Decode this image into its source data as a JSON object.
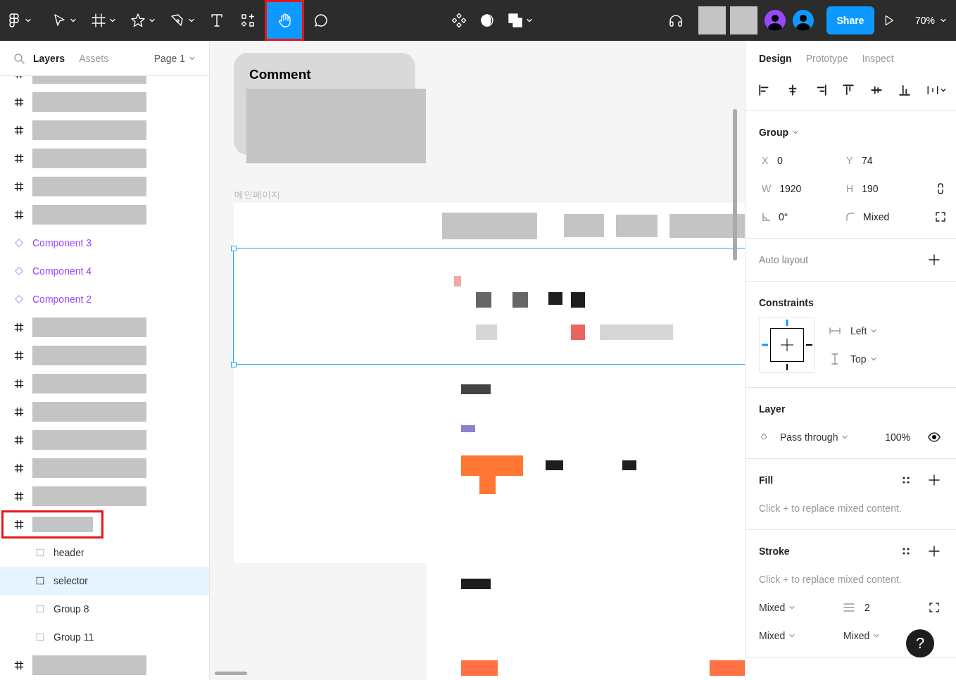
{
  "toolbar": {
    "tools": [
      {
        "kind": "logo",
        "caret": true,
        "selected": false,
        "annotated": false
      },
      {
        "kind": "move",
        "caret": true,
        "selected": false,
        "annotated": false
      },
      {
        "kind": "frame",
        "caret": true,
        "selected": false,
        "annotated": false
      },
      {
        "kind": "shape",
        "caret": true,
        "selected": false,
        "annotated": false
      },
      {
        "kind": "pen",
        "caret": true,
        "selected": false,
        "annotated": false
      },
      {
        "kind": "text",
        "caret": false,
        "selected": false,
        "annotated": false
      },
      {
        "kind": "resources",
        "caret": false,
        "selected": false,
        "annotated": false
      },
      {
        "kind": "hand",
        "caret": false,
        "selected": true,
        "annotated": true
      },
      {
        "kind": "comment",
        "caret": false,
        "selected": false,
        "annotated": false
      }
    ],
    "center_tools": [
      {
        "kind": "component",
        "caret": false
      },
      {
        "kind": "mask",
        "caret": false
      },
      {
        "kind": "boolean",
        "caret": true
      }
    ],
    "avatars": [
      {
        "color": "#9747ff"
      },
      {
        "color": "#0d99ff"
      }
    ],
    "share": "Share",
    "zoom": "70%"
  },
  "layers": {
    "tabs": [
      {
        "label": "Layers",
        "selected": true
      },
      {
        "label": "Assets",
        "selected": false
      }
    ],
    "page": "Page 1",
    "items": [
      {
        "kind": "frame",
        "redacted": true,
        "selected": false,
        "annotated": false
      },
      {
        "kind": "frame",
        "redacted": true,
        "selected": false,
        "annotated": false
      },
      {
        "kind": "frame",
        "redacted": true,
        "selected": false,
        "annotated": false
      },
      {
        "kind": "frame",
        "redacted": true,
        "selected": false,
        "annotated": false
      },
      {
        "kind": "frame",
        "redacted": true,
        "selected": false,
        "annotated": false
      },
      {
        "kind": "frame",
        "redacted": true,
        "selected": false,
        "annotated": false
      },
      {
        "kind": "component",
        "label": "Component 3",
        "selected": false,
        "annotated": false
      },
      {
        "kind": "component",
        "label": "Component 4",
        "selected": false,
        "annotated": false
      },
      {
        "kind": "component",
        "label": "Component 2",
        "selected": false,
        "annotated": false
      },
      {
        "kind": "frame",
        "redacted": true,
        "selected": false,
        "annotated": false
      },
      {
        "kind": "frame",
        "redacted": true,
        "selected": false,
        "annotated": false
      },
      {
        "kind": "frame",
        "redacted": true,
        "selected": false,
        "annotated": false
      },
      {
        "kind": "frame",
        "redacted": true,
        "selected": false,
        "annotated": false
      },
      {
        "kind": "frame",
        "redacted": true,
        "selected": false,
        "annotated": false
      },
      {
        "kind": "frame",
        "redacted": true,
        "selected": false,
        "annotated": false
      },
      {
        "kind": "frame",
        "redacted": true,
        "selected": false,
        "annotated": false
      },
      {
        "kind": "frame",
        "redacted": true,
        "selected": false,
        "annotated": true,
        "children": [
          {
            "kind": "group",
            "label": "header",
            "selected": false,
            "annotated": false
          },
          {
            "kind": "group",
            "label": "selector",
            "selected": true,
            "annotated": false
          },
          {
            "kind": "group",
            "label": "Group 8",
            "selected": false,
            "annotated": false
          },
          {
            "kind": "group",
            "label": "Group 11",
            "selected": false,
            "annotated": false
          }
        ]
      },
      {
        "kind": "frame",
        "redacted": true,
        "selected": false,
        "annotated": false
      }
    ]
  },
  "canvas": {
    "comment_card": {
      "title": "Comment"
    },
    "frame_label": "메인페이지"
  },
  "design_panel": {
    "tabs": [
      {
        "label": "Design",
        "selected": true
      },
      {
        "label": "Prototype",
        "selected": false
      },
      {
        "label": "Inspect",
        "selected": false
      }
    ],
    "selection": {
      "title": "Group",
      "fields": [
        {
          "kind": "labeled",
          "label": "X",
          "value": "0"
        },
        {
          "kind": "labeled",
          "label": "Y",
          "value": "74"
        },
        {
          "kind": "labeled",
          "label": "W",
          "value": "1920"
        },
        {
          "kind": "labeled",
          "label": "H",
          "value": "190"
        },
        {
          "kind": "rotation",
          "value": "0°"
        },
        {
          "kind": "radius",
          "value": "Mixed"
        }
      ]
    },
    "auto_layout": {
      "title": "Auto layout"
    },
    "constraints": {
      "title": "Constraints",
      "horizontal": "Left",
      "vertical": "Top"
    },
    "layer": {
      "title": "Layer",
      "blend": "Pass through",
      "opacity": "100%",
      "visible": true
    },
    "fill": {
      "title": "Fill",
      "hint": "Click + to replace mixed content."
    },
    "stroke": {
      "title": "Stroke",
      "hint": "Click + to replace mixed content.",
      "position": "Mixed",
      "weight": "2",
      "join": "Mixed",
      "cap": "Mixed"
    }
  },
  "help": "?"
}
